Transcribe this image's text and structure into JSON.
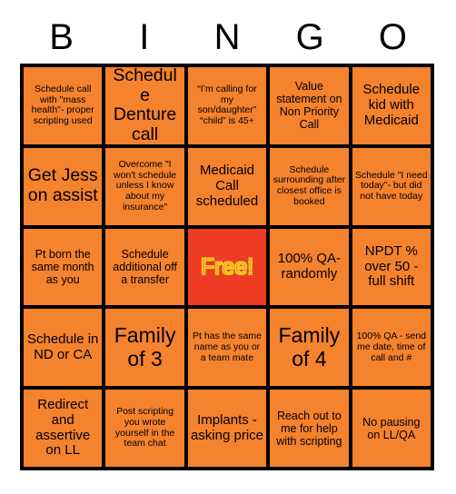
{
  "card": {
    "title_letters": [
      "B",
      "I",
      "N",
      "G",
      "O"
    ],
    "colors": {
      "cell_background": "#F5822D",
      "free_background": "#EE3B24",
      "free_text": "#F0852F",
      "free_outline": "#F5D020",
      "grid_line": "#000000",
      "text": "#000000",
      "page_background": "#FFFFFF"
    },
    "rows": [
      [
        {
          "text": "Schedule call with \"mass health\"- proper scripting used",
          "size": "xs",
          "free": false
        },
        {
          "text": "Schedule Denture call",
          "size": "l",
          "free": false
        },
        {
          "text": "“I’m calling for my son/daughter” “child” is 45+",
          "size": "xs",
          "free": false
        },
        {
          "text": "Value statement on Non Priority Call",
          "size": "s",
          "free": false
        },
        {
          "text": "Schedule kid with Medicaid",
          "size": "m",
          "free": false
        }
      ],
      [
        {
          "text": "Get Jess on assist",
          "size": "l",
          "free": false
        },
        {
          "text": "Overcome \"I won't schedule unless I know about my insurance\"",
          "size": "xs",
          "free": false
        },
        {
          "text": "Medicaid Call scheduled",
          "size": "m",
          "free": false
        },
        {
          "text": "Schedule surrounding after closest office is booked",
          "size": "xs",
          "free": false
        },
        {
          "text": "Schedule \"I need today\"- but did not have today",
          "size": "xs",
          "free": false
        }
      ],
      [
        {
          "text": "Pt born the same month as you",
          "size": "s",
          "free": false
        },
        {
          "text": "Schedule additional off a transfer",
          "size": "s",
          "free": false
        },
        {
          "text": "Free!",
          "size": "xl",
          "free": true
        },
        {
          "text": "100% QA- randomly",
          "size": "m",
          "free": false
        },
        {
          "text": "NPDT % over 50 - full shift",
          "size": "m",
          "free": false
        }
      ],
      [
        {
          "text": "Schedule in ND or CA",
          "size": "m",
          "free": false
        },
        {
          "text": "Family of 3",
          "size": "xl",
          "free": false
        },
        {
          "text": "Pt has the same name as you or a team mate",
          "size": "xs",
          "free": false
        },
        {
          "text": "Family of 4",
          "size": "xl",
          "free": false
        },
        {
          "text": "100% QA - send me date, time of call and #",
          "size": "xs",
          "free": false
        }
      ],
      [
        {
          "text": "Redirect and assertive on LL",
          "size": "m",
          "free": false
        },
        {
          "text": "Post scripting you wrote yourself in the team chat",
          "size": "xs",
          "free": false
        },
        {
          "text": "Implants - asking price",
          "size": "m",
          "free": false
        },
        {
          "text": "Reach out to me for help with scripting",
          "size": "s",
          "free": false
        },
        {
          "text": "No pausing on LL/QA",
          "size": "s",
          "free": false
        }
      ]
    ]
  }
}
